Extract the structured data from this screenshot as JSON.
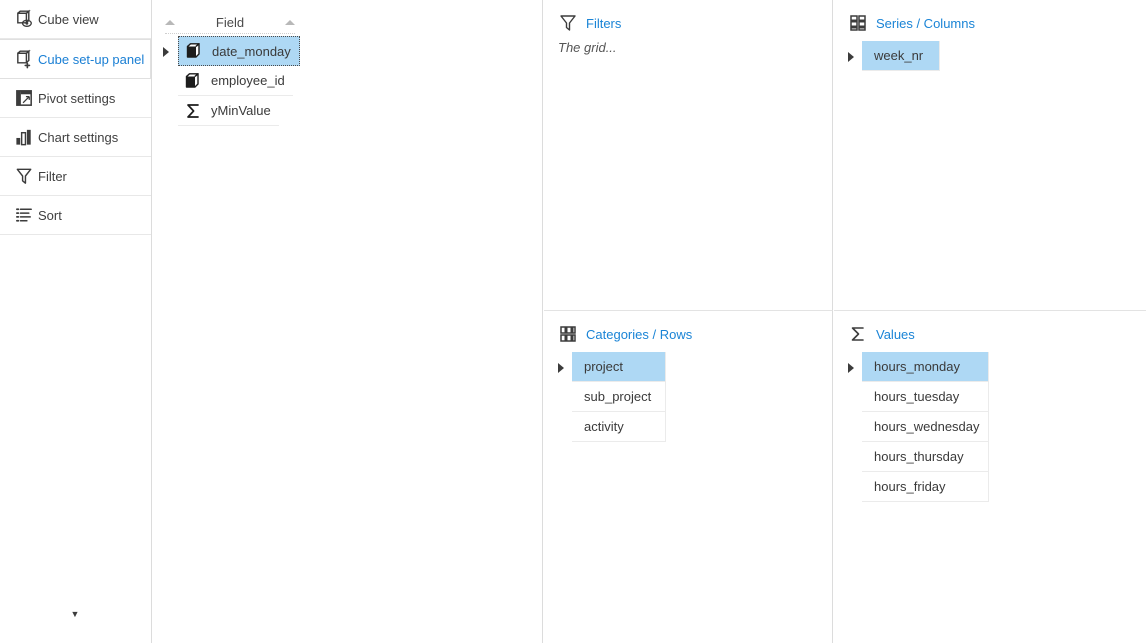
{
  "sidebar": {
    "items": [
      {
        "label": "Cube view",
        "icon": "cube-view-icon",
        "selected": false
      },
      {
        "label": "Cube set-up panel",
        "icon": "cube-setup-icon",
        "selected": true
      },
      {
        "label": "Pivot settings",
        "icon": "pivot-settings-icon",
        "selected": false
      },
      {
        "label": "Chart settings",
        "icon": "chart-settings-icon",
        "selected": false
      },
      {
        "label": "Filter",
        "icon": "filter-funnel-icon",
        "selected": false
      },
      {
        "label": "Sort",
        "icon": "sort-list-icon",
        "selected": false
      }
    ],
    "scroll_down_icon": "chevron-down-icon"
  },
  "field_panel": {
    "header_title": "Field",
    "sort_asc_icon": "sort-ascending-icon",
    "sort_desc_icon": "sort-ascending-icon",
    "fields": [
      {
        "label": "date_monday",
        "icon": "dimension-cube-icon",
        "selected": true,
        "draggable": true
      },
      {
        "label": "employee_id",
        "icon": "dimension-cube-icon",
        "selected": false,
        "draggable": false
      },
      {
        "label": "yMinValue",
        "icon": "measure-sigma-icon",
        "selected": false,
        "draggable": false
      }
    ]
  },
  "zones": {
    "filters": {
      "title": "Filters",
      "icon": "filter-funnel-icon",
      "empty_text": "The grid...",
      "items": []
    },
    "series": {
      "title": "Series / Columns",
      "icon": "columns-grid-icon",
      "items": [
        {
          "label": "week_nr",
          "selected": true,
          "draggable": true
        }
      ]
    },
    "categories": {
      "title": "Categories / Rows",
      "icon": "rows-grid-icon",
      "items": [
        {
          "label": "project",
          "selected": true,
          "draggable": true
        },
        {
          "label": "sub_project",
          "selected": false,
          "draggable": false
        },
        {
          "label": "activity",
          "selected": false,
          "draggable": false
        }
      ]
    },
    "values": {
      "title": "Values",
      "icon": "measure-sigma-icon",
      "items": [
        {
          "label": "hours_monday",
          "selected": true,
          "draggable": true
        },
        {
          "label": "hours_tuesday",
          "selected": false,
          "draggable": false
        },
        {
          "label": "hours_wednesday",
          "selected": false,
          "draggable": false
        },
        {
          "label": "hours_thursday",
          "selected": false,
          "draggable": false
        },
        {
          "label": "hours_friday",
          "selected": false,
          "draggable": false
        }
      ]
    }
  },
  "colors": {
    "accent_blue": "#1a84d6",
    "selection_blue": "#aed8f4",
    "text": "#3a3a3a",
    "border": "#dcdcdc"
  }
}
